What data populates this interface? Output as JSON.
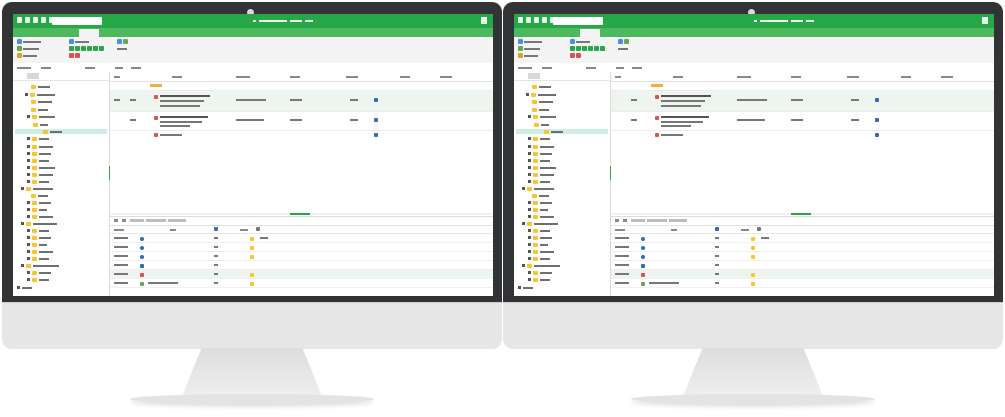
{
  "colors": {
    "brand_green": "#27a748",
    "tab_green": "#4cba5c",
    "folder_yellow": "#f7c437",
    "bezel": "#323335"
  },
  "screen": {
    "titlebar": {
      "left_icons": [
        "filter-icon",
        "list-icon",
        "mail-icon",
        "refresh-icon",
        "sync-icon"
      ],
      "close_icon": "close-icon"
    },
    "ribbon": {
      "icons": [
        "new-icon",
        "copy-icon",
        "edit-icon",
        "play-icon",
        "forward-icon",
        "delete-icon",
        "flag-icon"
      ]
    },
    "sidebar": {
      "folders": 30
    },
    "grid": {
      "row_icons": [
        "mail-icon",
        "mail-icon",
        "mail-icon"
      ]
    },
    "bottom": {
      "row_icons": [
        "user-icon",
        "user-icon",
        "user-icon",
        "user-icon",
        "pdf-icon",
        "doc-icon",
        "info-icon"
      ]
    }
  }
}
